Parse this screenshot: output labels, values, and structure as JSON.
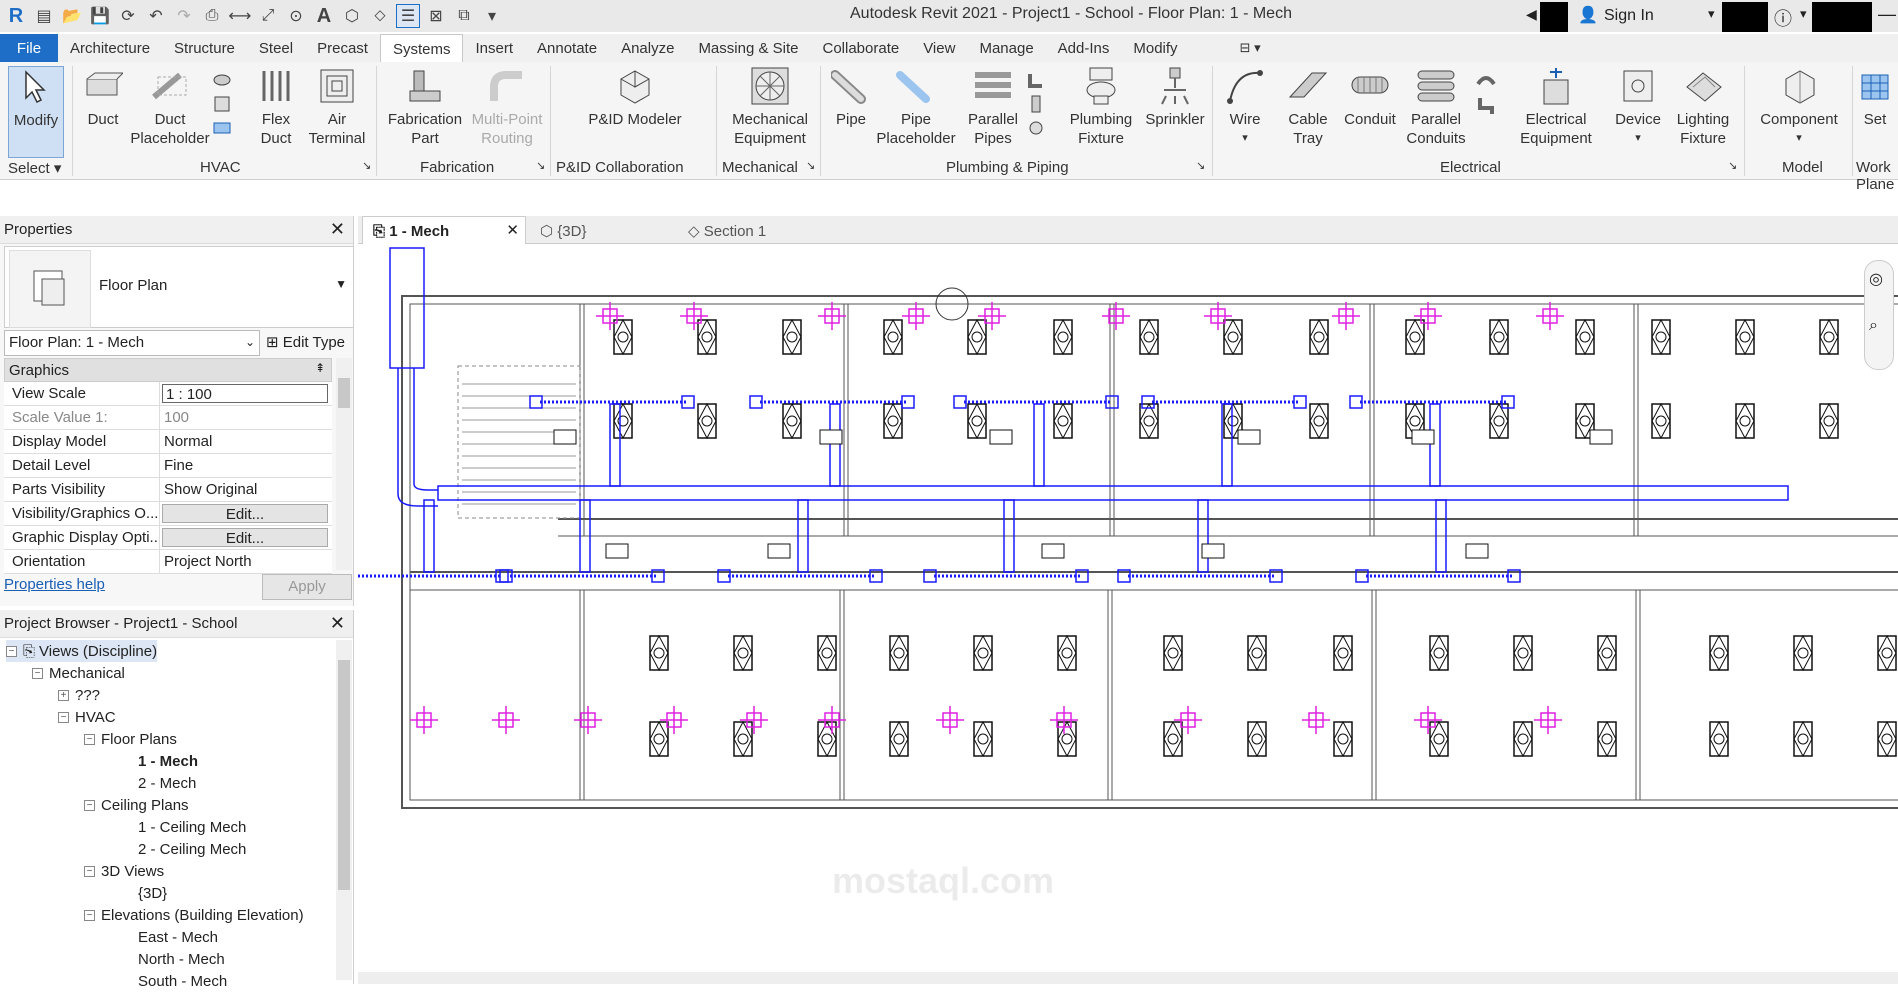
{
  "window": {
    "title": "Autodesk Revit 2021 - Project1 - School - Floor Plan: 1 - Mech",
    "sign_in": "Sign In",
    "quick_access_icons": [
      "revit-logo-icon",
      "open-icon",
      "save-icon",
      "sync-icon",
      "undo-icon",
      "redo-icon",
      "print-icon",
      "measure-icon",
      "dimension-icon",
      "tag-icon",
      "text-icon",
      "3d-view-icon",
      "section-icon",
      "thin-lines-icon",
      "close-hidden-icon",
      "switch-windows-icon",
      "customize-icon"
    ]
  },
  "menu": {
    "file": "File",
    "tabs": [
      "Architecture",
      "Structure",
      "Steel",
      "Precast",
      "Systems",
      "Insert",
      "Annotate",
      "Analyze",
      "Massing & Site",
      "Collaborate",
      "View",
      "Manage",
      "Add-Ins",
      "Modify"
    ],
    "active_tab": "Systems"
  },
  "ribbon": {
    "tools": {
      "modify": "Modify",
      "duct": "Duct",
      "duct_placeholder_1": "Duct",
      "duct_placeholder_2": "Placeholder",
      "flex_duct_1": "Flex",
      "flex_duct_2": "Duct",
      "air_terminal_1": "Air",
      "air_terminal_2": "Terminal",
      "fabrication_1": "Fabrication",
      "fabrication_2": "Part",
      "multipoint_1": "Multi-Point",
      "multipoint_2": "Routing",
      "pid_modeler": "P&ID Modeler",
      "mech_equip_1": "Mechanical",
      "mech_equip_2": "Equipment",
      "pipe": "Pipe",
      "pipe_placeholder_1": "Pipe",
      "pipe_placeholder_2": "Placeholder",
      "parallel_pipes_1": "Parallel",
      "parallel_pipes_2": "Pipes",
      "plumbing_1": "Plumbing",
      "plumbing_2": "Fixture",
      "sprinkler": "Sprinkler",
      "wire": "Wire",
      "cable_tray_1": "Cable",
      "cable_tray_2": "Tray",
      "conduit": "Conduit",
      "parallel_conduits_1": "Parallel",
      "parallel_conduits_2": "Conduits",
      "electrical_equip_1": "Electrical",
      "electrical_equip_2": "Equipment",
      "device": "Device",
      "lighting_1": "Lighting",
      "lighting_2": "Fixture",
      "component": "Component",
      "set": "Set"
    },
    "panels": {
      "select": "Select",
      "hvac": "HVAC",
      "fabrication": "Fabrication",
      "pid": "P&ID Collaboration",
      "mechanical": "Mechanical",
      "plumbing": "Plumbing & Piping",
      "electrical": "Electrical",
      "model": "Model",
      "work_plane": "Work Plane"
    }
  },
  "properties": {
    "title": "Properties",
    "type_name": "Floor Plan",
    "instance": "Floor Plan: 1 - Mech",
    "edit_type": "Edit Type",
    "group": "Graphics",
    "rows": [
      {
        "key": "View Scale",
        "value": "1 : 100"
      },
      {
        "key": "Scale Value    1:",
        "value": "100"
      },
      {
        "key": "Display Model",
        "value": "Normal"
      },
      {
        "key": "Detail Level",
        "value": "Fine"
      },
      {
        "key": "Parts Visibility",
        "value": "Show Original"
      },
      {
        "key": "Visibility/Graphics O...",
        "value": "Edit..."
      },
      {
        "key": "Graphic Display Opti...",
        "value": "Edit..."
      },
      {
        "key": "Orientation",
        "value": "Project North"
      }
    ],
    "help": "Properties help",
    "apply": "Apply"
  },
  "browser": {
    "title": "Project Browser - Project1 - School",
    "items": {
      "views": "Views (Discipline)",
      "mechanical": "Mechanical",
      "unknown": "???",
      "hvac": "HVAC",
      "floor_plans": "Floor Plans",
      "fp1": "1 - Mech",
      "fp2": "2 - Mech",
      "ceiling_plans": "Ceiling Plans",
      "cp1": "1 - Ceiling Mech",
      "cp2": "2 - Ceiling Mech",
      "views3d": "3D Views",
      "v3d": "{3D}",
      "elevations": "Elevations (Building Elevation)",
      "east": "East - Mech",
      "north": "North - Mech",
      "south": "South - Mech"
    }
  },
  "view_tabs": [
    "1 - Mech",
    "{3D}",
    "Section 1"
  ],
  "watermark": "mostaql.com",
  "colors": {
    "duct": "#1a1aff",
    "diffuser": "#e020e0",
    "walls": "#555555",
    "ribbon_active": "#1e6ec8"
  }
}
